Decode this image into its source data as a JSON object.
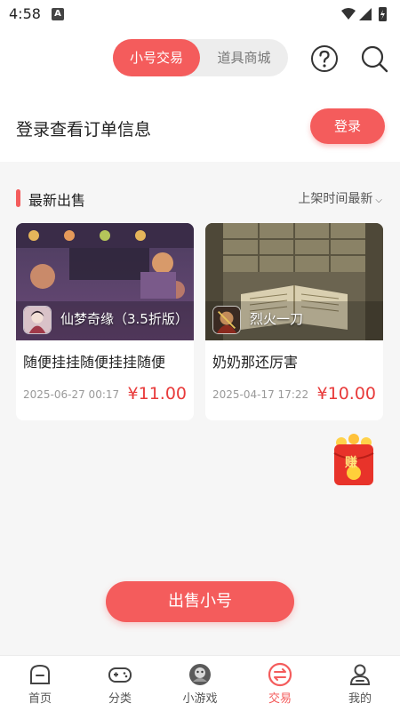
{
  "status_bar": {
    "time": "4:58",
    "notification_letter": "A"
  },
  "header": {
    "tabs": [
      {
        "label": "小号交易",
        "active": true
      },
      {
        "label": "道具商城",
        "active": false
      }
    ],
    "help_icon": "question-circle-icon",
    "search_icon": "search-icon"
  },
  "login_prompt": {
    "text": "登录查看订单信息",
    "button_label": "登录"
  },
  "section": {
    "title": "最新出售",
    "sort_label": "上架时间最新"
  },
  "listings": [
    {
      "game_name": "仙梦奇缘（3.5折版）",
      "title": "随便挂挂随便挂挂随便",
      "date": "2025-06-27 00:17",
      "price": "¥11.00"
    },
    {
      "game_name": "烈火一刀",
      "title": "奶奶那还厉害",
      "date": "2025-04-17 17:22",
      "price": "¥10.00"
    }
  ],
  "promo": {
    "badge_text": "赚"
  },
  "sell_button": {
    "label": "出售小号"
  },
  "tab_bar": [
    {
      "label": "首页",
      "icon": "home-icon",
      "active": false
    },
    {
      "label": "分类",
      "icon": "gamepad-icon",
      "active": false
    },
    {
      "label": "小游戏",
      "icon": "mini-game-icon",
      "active": false
    },
    {
      "label": "交易",
      "icon": "exchange-icon",
      "active": true
    },
    {
      "label": "我的",
      "icon": "user-icon",
      "active": false
    }
  ],
  "colors": {
    "accent": "#f45c5c",
    "price": "#e83a3a",
    "background": "#f6f6f6"
  }
}
